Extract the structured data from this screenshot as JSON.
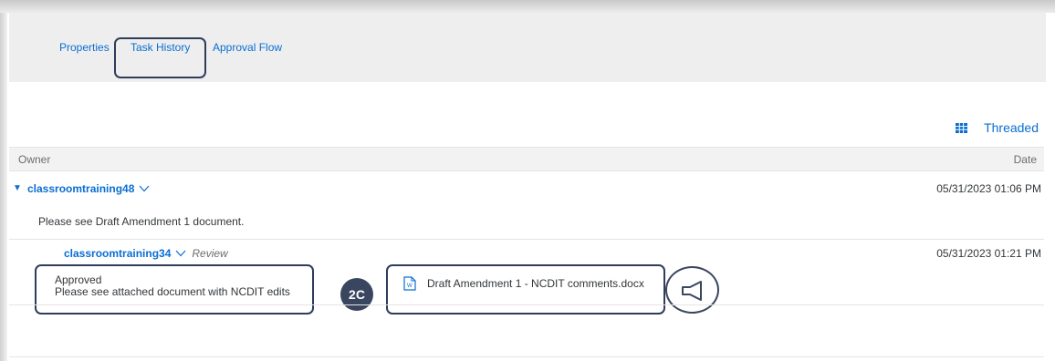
{
  "tabs": [
    {
      "label": "Properties"
    },
    {
      "label": "Task History"
    },
    {
      "label": "Approval Flow"
    }
  ],
  "view_toggle": {
    "label": "Threaded",
    "icon": "table-grid-icon"
  },
  "table": {
    "owner_header": "Owner",
    "date_header": "Date"
  },
  "entries": [
    {
      "owner": "classroomtraining48",
      "date": "05/31/2023 01:06 PM",
      "comment": "Please see Draft Amendment 1 document."
    },
    {
      "owner": "classroomtraining34",
      "action": "Review",
      "date": "05/31/2023 01:21 PM",
      "status": "Approved",
      "comment": "Please see attached document with NCDIT edits",
      "attachment": "Draft Amendment 1 - NCDIT comments.docx"
    }
  ],
  "callout_label": "2C",
  "colors": {
    "link": "#0a6ed1",
    "callout": "#3a4660",
    "highlight_border": "#2f3d5a"
  }
}
